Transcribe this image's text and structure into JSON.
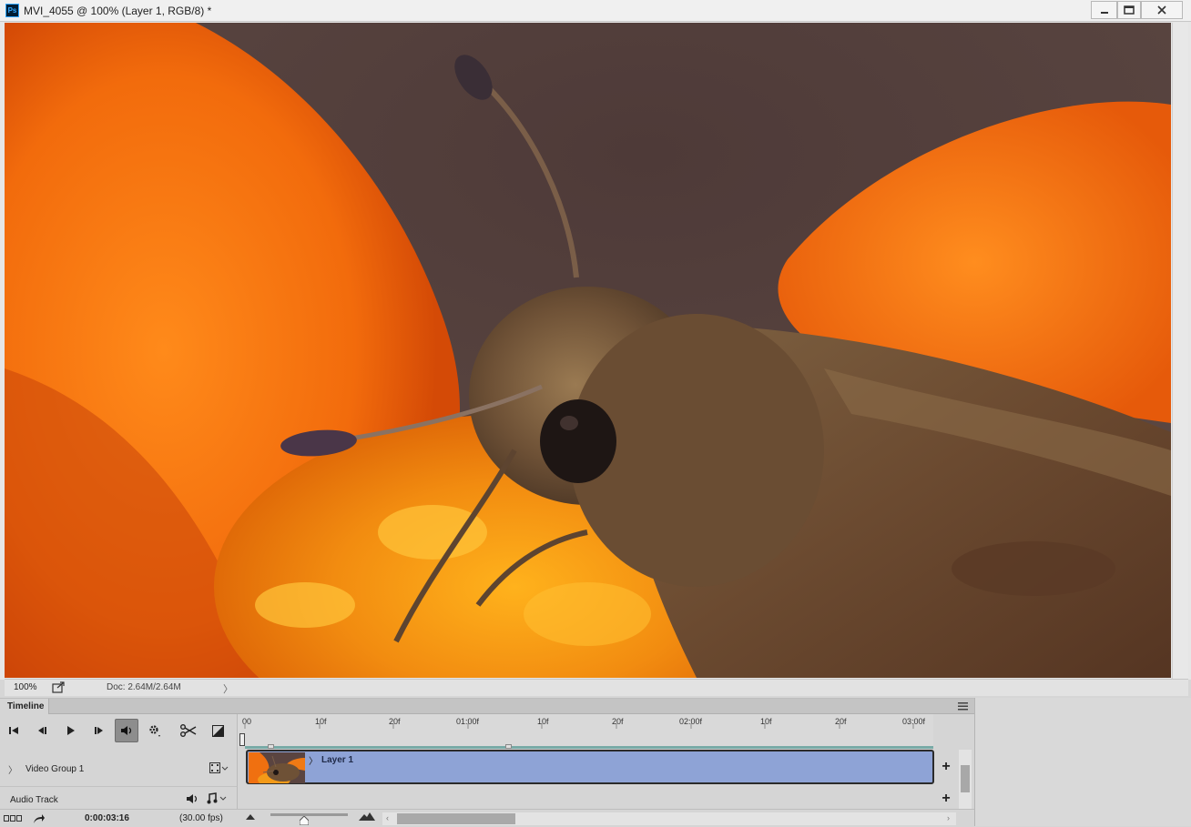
{
  "window": {
    "app_badge": "Ps",
    "title": "MVI_4055 @ 100% (Layer 1, RGB/8) *"
  },
  "status": {
    "zoom": "100%",
    "doc_size": "Doc: 2.64M/2.64M",
    "arrow": "〉"
  },
  "timeline": {
    "tab_label": "Timeline",
    "ruler_labels": [
      "00",
      "10f",
      "20f",
      "01:00f",
      "10f",
      "20f",
      "02:00f",
      "10f",
      "20f",
      "03:00f"
    ],
    "video_group_label": "Video Group 1",
    "audio_track_label": "Audio Track",
    "clip_name": "Layer 1",
    "timecode": "0:00:03:16",
    "fps": "(30.00 fps)",
    "add_track_symbol": "+",
    "expand_symbol": "〉"
  },
  "icons": {
    "first_frame": "first-frame-icon",
    "prev_frame": "previous-frame-icon",
    "play": "play-icon",
    "next_frame": "next-frame-icon",
    "audio": "speaker-icon",
    "settings": "gear-icon",
    "split": "scissors-icon",
    "transition": "transition-icon"
  },
  "colors": {
    "clip_fill": "#8ea3d6",
    "audio_button_active": "#8d8d8d",
    "work_area": "#78aaa6",
    "ps_brand": "#31a8ff"
  }
}
